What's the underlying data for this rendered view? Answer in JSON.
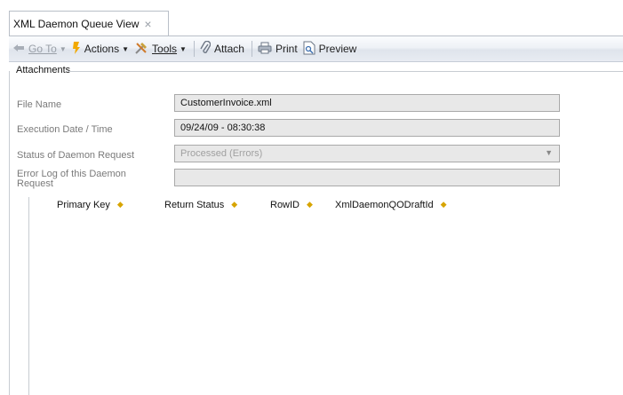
{
  "tab": {
    "title": "XML Daemon Queue View",
    "close": "×"
  },
  "toolbar": {
    "goto": "Go To",
    "actions": "Actions",
    "tools": "Tools",
    "attach": "Attach",
    "print": "Print",
    "preview": "Preview"
  },
  "group": {
    "title": "Attachments"
  },
  "form": {
    "file_name_label": "File Name",
    "file_name_value": "CustomerInvoice.xml",
    "exec_label": "Execution Date / Time",
    "exec_value": "09/24/09 - 08:30:38",
    "status_label": "Status of Daemon Request",
    "status_value": "Processed (Errors)",
    "error_label_1": "Error Log of this Daemon",
    "error_label_2": "Request",
    "error_value": ""
  },
  "grid": {
    "columns": [
      "Primary Key",
      "Return Status",
      "RowID",
      "XmlDaemonQODraftId"
    ]
  }
}
